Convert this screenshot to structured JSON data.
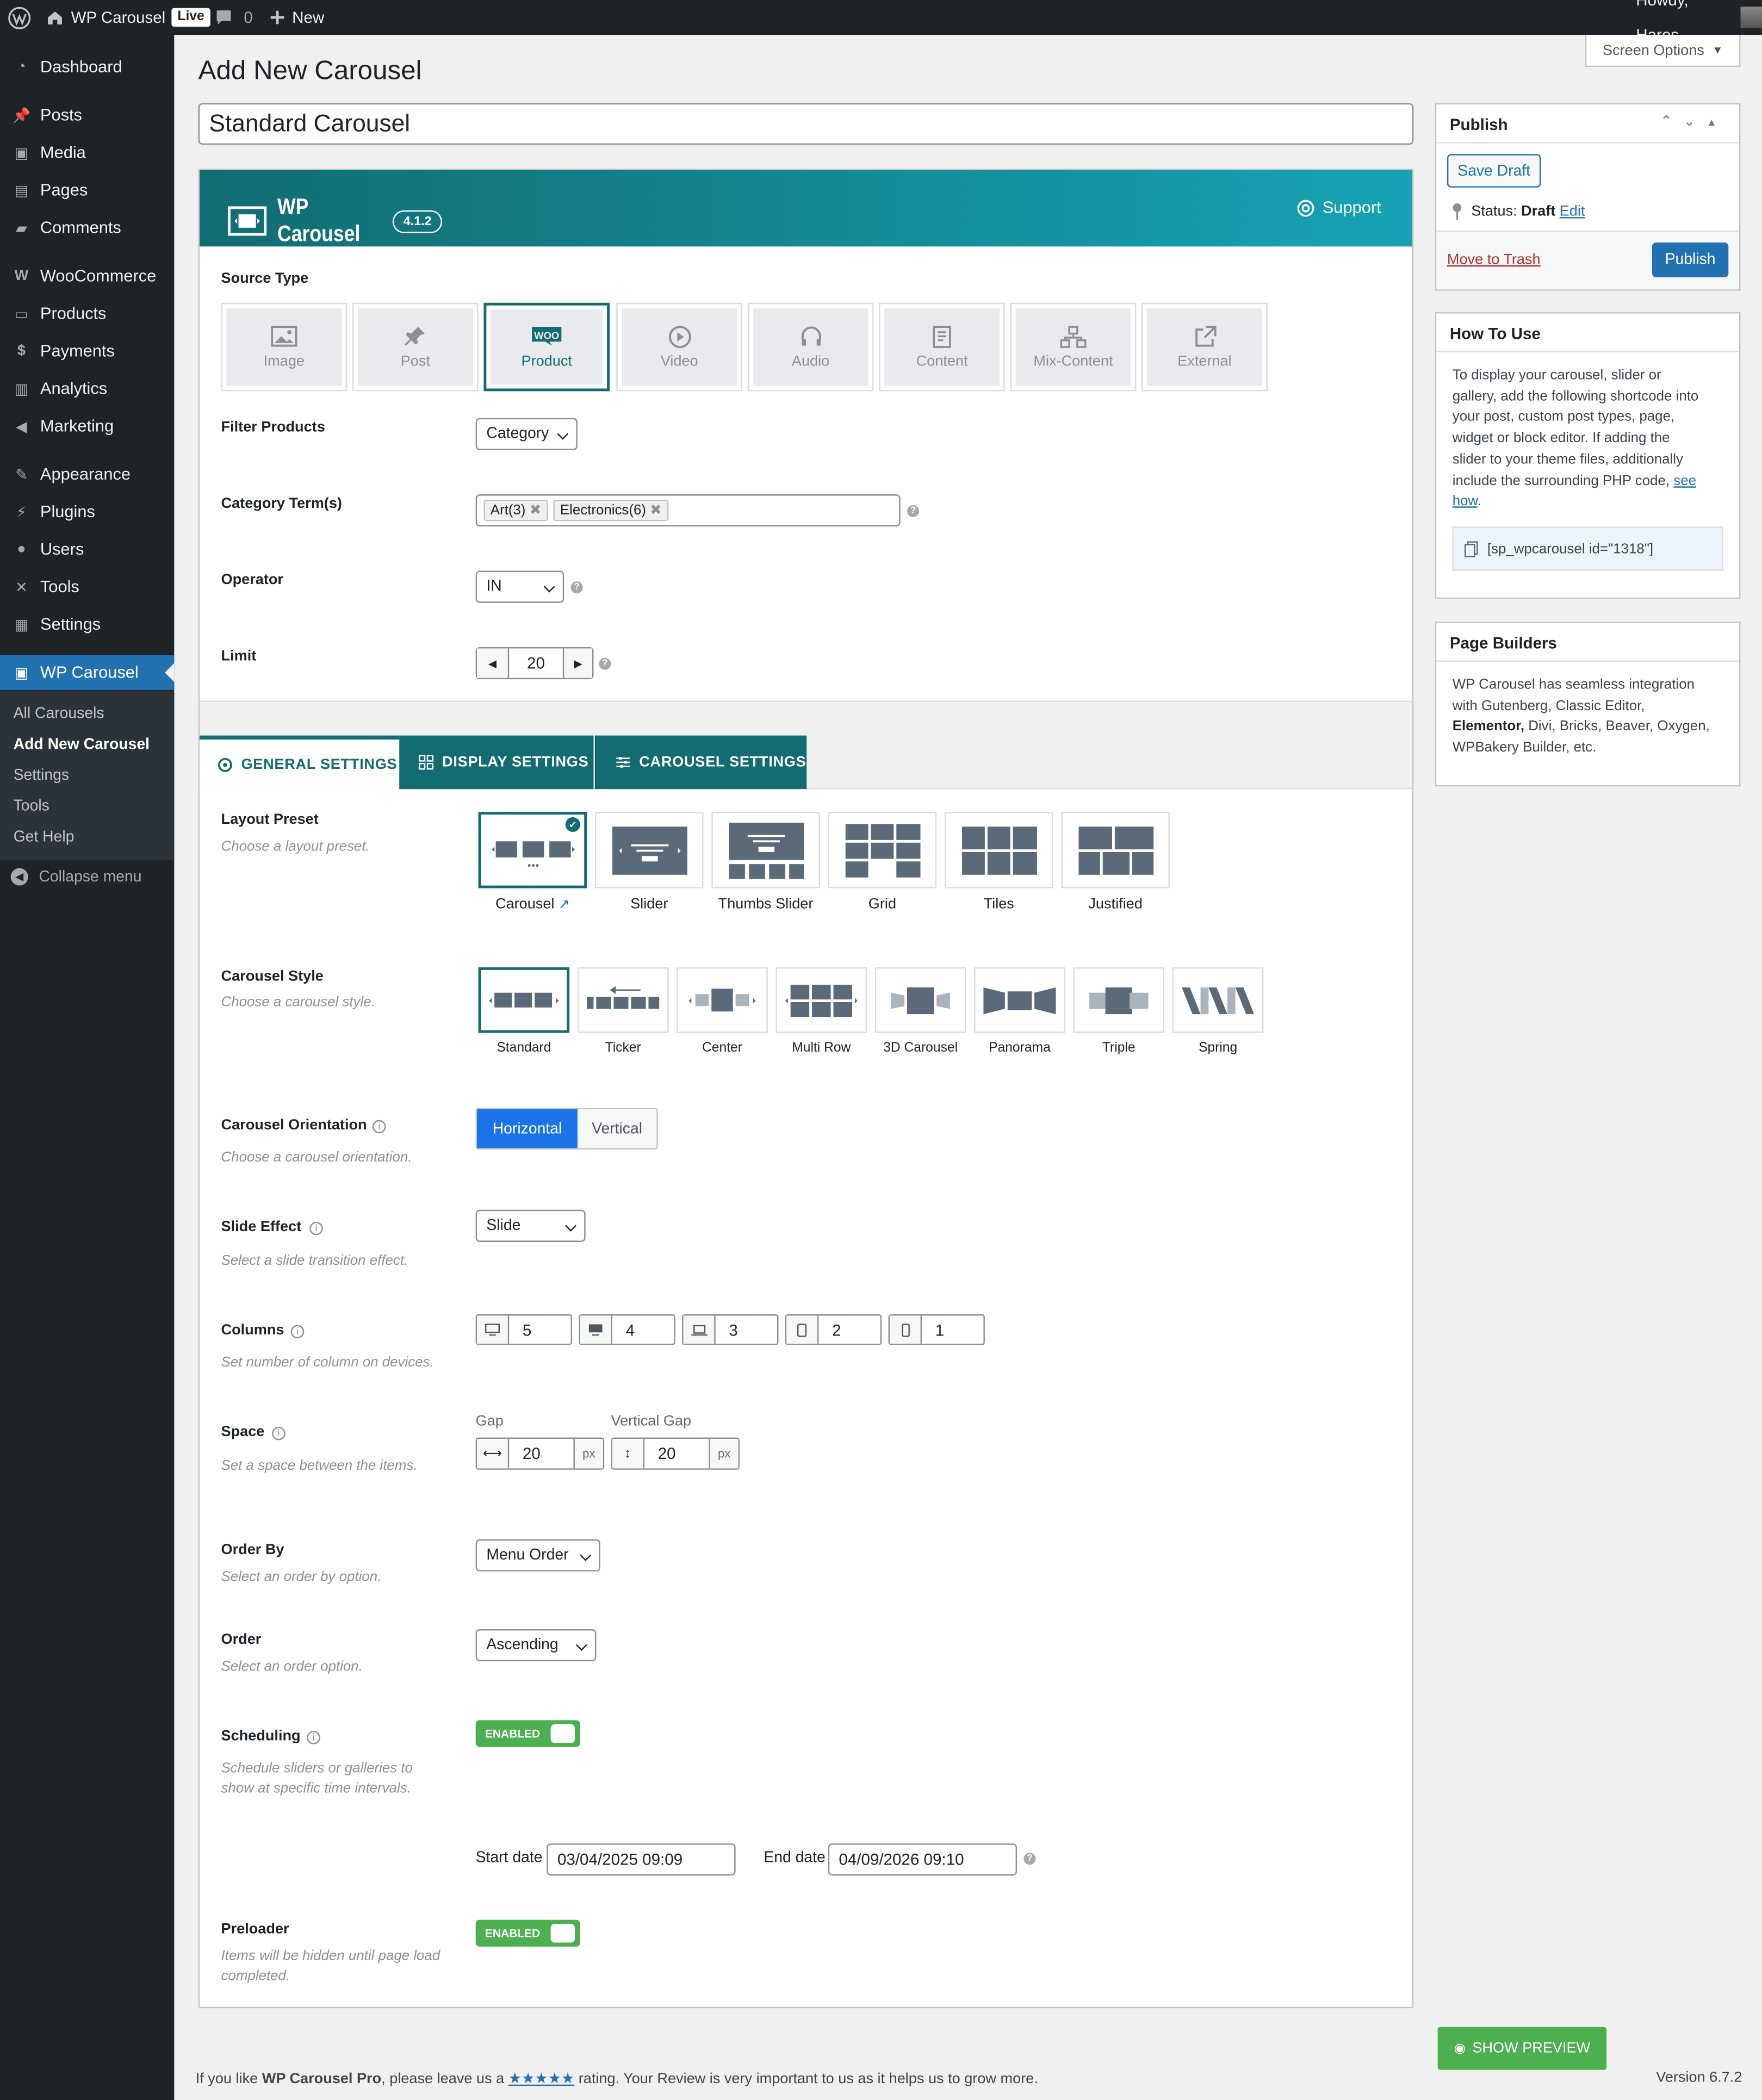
{
  "admin_bar": {
    "site_name": "WP Carousel",
    "live_badge": "Live",
    "comments_count": "0",
    "new_label": "New",
    "howdy": "Howdy, Hares"
  },
  "sidebar": {
    "items": [
      {
        "label": "Dashboard",
        "icon": "dashboard-icon"
      },
      {
        "label": "Posts",
        "icon": "pin-icon"
      },
      {
        "label": "Media",
        "icon": "media-icon"
      },
      {
        "label": "Pages",
        "icon": "pages-icon"
      },
      {
        "label": "Comments",
        "icon": "comments-icon"
      },
      {
        "label": "WooCommerce",
        "icon": "woocommerce-icon"
      },
      {
        "label": "Products",
        "icon": "products-icon"
      },
      {
        "label": "Payments",
        "icon": "payments-icon"
      },
      {
        "label": "Analytics",
        "icon": "analytics-icon"
      },
      {
        "label": "Marketing",
        "icon": "marketing-icon"
      },
      {
        "label": "Appearance",
        "icon": "brush-icon"
      },
      {
        "label": "Plugins",
        "icon": "plugin-icon"
      },
      {
        "label": "Users",
        "icon": "users-icon"
      },
      {
        "label": "Tools",
        "icon": "wrench-icon"
      },
      {
        "label": "Settings",
        "icon": "settings-icon"
      },
      {
        "label": "WP Carousel",
        "icon": "carousel-icon"
      }
    ],
    "submenu": [
      "All Carousels",
      "Add New Carousel",
      "Settings",
      "Tools",
      "Get Help"
    ],
    "collapse": "Collapse menu"
  },
  "page": {
    "title": "Add New Carousel",
    "screen_options": "Screen Options",
    "post_title": "Standard Carousel"
  },
  "plugin_header": {
    "name": "WP Carousel",
    "version": "4.1.2",
    "support": "Support"
  },
  "source": {
    "label": "Source Type",
    "types": [
      "Image",
      "Post",
      "Product",
      "Video",
      "Audio",
      "Content",
      "Mix-Content",
      "External"
    ],
    "selected": "Product"
  },
  "filter": {
    "label": "Filter Products",
    "value": "Category"
  },
  "terms": {
    "label": "Category Term(s)",
    "tags": [
      "Art(3)",
      "Electronics(6)"
    ]
  },
  "operator": {
    "label": "Operator",
    "value": "IN"
  },
  "limit": {
    "label": "Limit",
    "value": "20"
  },
  "tabs": [
    "GENERAL SETTINGS",
    "DISPLAY SETTINGS",
    "CAROUSEL SETTINGS"
  ],
  "layout": {
    "label": "Layout Preset",
    "help": "Choose a layout preset.",
    "presets": [
      "Carousel",
      "Slider",
      "Thumbs Slider",
      "Grid",
      "Tiles",
      "Justified"
    ]
  },
  "style": {
    "label": "Carousel Style",
    "help": "Choose a carousel style.",
    "styles": [
      "Standard",
      "Ticker",
      "Center",
      "Multi Row",
      "3D Carousel",
      "Panorama",
      "Triple",
      "Spring"
    ]
  },
  "orientation": {
    "label": "Carousel Orientation",
    "help": "Choose a carousel orientation.",
    "options": [
      "Horizontal",
      "Vertical"
    ]
  },
  "effect": {
    "label": "Slide Effect",
    "help": "Select a slide transition effect.",
    "value": "Slide"
  },
  "columns": {
    "label": "Columns",
    "help": "Set number of column on devices.",
    "values": [
      "5",
      "4",
      "3",
      "2",
      "1"
    ]
  },
  "space": {
    "label": "Space",
    "help": "Set a space between the items.",
    "gap_label": "Gap",
    "gap": "20",
    "vgap_label": "Vertical Gap",
    "vgap": "20",
    "unit": "px"
  },
  "orderby": {
    "label": "Order By",
    "help": "Select an order by option.",
    "value": "Menu Order"
  },
  "order": {
    "label": "Order",
    "help": "Select an order option.",
    "value": "Ascending"
  },
  "scheduling": {
    "label": "Scheduling",
    "help1": "Schedule sliders or galleries to",
    "help2": "show at specific time intervals.",
    "toggle": "ENABLED",
    "start_label": "Start date",
    "start": "03/04/2025 09:09",
    "end_label": "End date",
    "end": "04/09/2026 09:10"
  },
  "preloader": {
    "label": "Preloader",
    "help1": "Items will be hidden until page load",
    "help2": "completed.",
    "toggle": "ENABLED"
  },
  "publish": {
    "title": "Publish",
    "save_draft": "Save Draft",
    "status_label": "Status:",
    "status": "Draft",
    "edit": "Edit",
    "trash": "Move to Trash",
    "publish": "Publish"
  },
  "howto": {
    "title": "How To Use",
    "lines": [
      "To display your carousel, slider or",
      "gallery, add the following shortcode into",
      "your post, custom post types, page,",
      "widget or block editor. If adding the",
      "slider to your theme files, additionally",
      "include the surrounding PHP code,"
    ],
    "see": "see",
    "how": "how",
    "shortcode": "[sp_wpcarousel id=\"1318\"]"
  },
  "builders": {
    "title": "Page Builders",
    "lines": [
      "WP Carousel has seamless integration",
      "with Gutenberg, Classic Editor,"
    ],
    "bold": "Elementor,",
    "rest": " Divi, Bricks, Beaver, Oxygen,",
    "last": "WPBakery Builder, etc."
  },
  "preview": "SHOW PREVIEW",
  "footer": {
    "pre": "If you like ",
    "brand": "WP Carousel Pro",
    "mid": ", please leave us a ",
    "stars": "★★★★★",
    "post": " rating. Your Review is very important to us as it helps us to grow more.",
    "version": "Version 6.7.2"
  },
  "colors": {
    "accent": "#126c72",
    "wp_blue": "#2271b1",
    "toggle_green": "#4caf50",
    "sidebar": "#1d2327"
  }
}
